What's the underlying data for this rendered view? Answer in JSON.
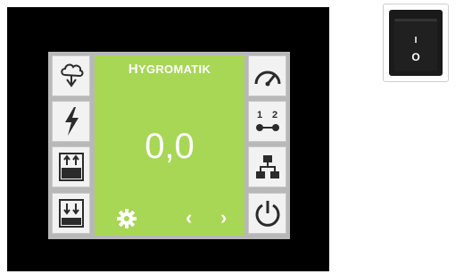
{
  "brand": {
    "prefix": "H",
    "rest": "YGROMATIK"
  },
  "display": {
    "value": "0,0"
  },
  "nav": {
    "prev_glyph": "‹",
    "next_glyph": "›"
  },
  "power_switch": {
    "on_mark": "I",
    "off_mark": "O"
  },
  "left_buttons": [
    {
      "icon": "humidifier-cloud-icon"
    },
    {
      "icon": "lightning-bolt-icon"
    },
    {
      "icon": "fill-up-icon"
    },
    {
      "icon": "drain-down-icon"
    }
  ],
  "right_buttons": [
    {
      "icon": "gauge-icon"
    },
    {
      "icon": "channel-1-2-icon",
      "labels": [
        "1",
        "2"
      ]
    },
    {
      "icon": "network-icon"
    },
    {
      "icon": "power-icon"
    }
  ],
  "colors": {
    "accent": "#a7d755",
    "bezel": "#000000",
    "button_bg": "#f2f2f2",
    "icon": "#2b2b2b"
  }
}
